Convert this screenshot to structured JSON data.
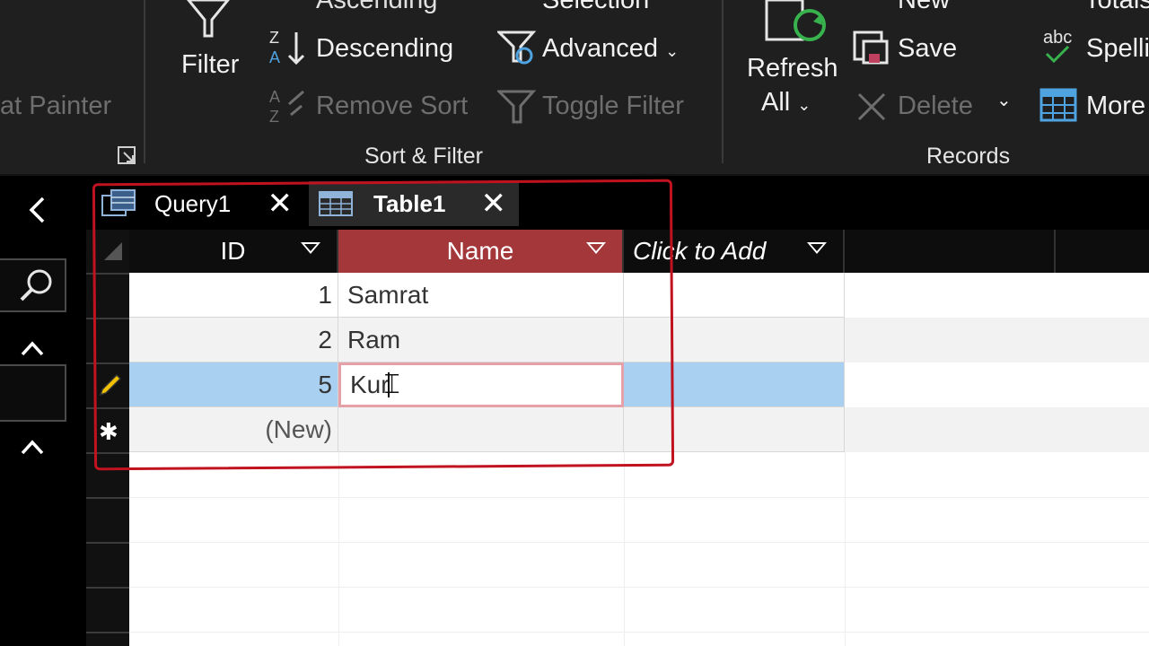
{
  "ribbon": {
    "partial_top": {
      "ascending": "Ascending",
      "selection": "Selection",
      "new": "New",
      "totals": "Totals"
    },
    "format_painter": "at Painter",
    "filter_label": "Filter",
    "descending": "Descending",
    "remove_sort": "Remove Sort",
    "advanced": "Advanced",
    "toggle_filter": "Toggle Filter",
    "group_sort_filter": "Sort & Filter",
    "refresh_line1": "Refresh",
    "refresh_line2": "All",
    "save": "Save",
    "delete": "Delete",
    "spelling": "Spelli",
    "more": "More",
    "group_records": "Records",
    "abc": "abc"
  },
  "tabs": [
    {
      "label": "Query1"
    },
    {
      "label": "Table1"
    }
  ],
  "datasheet": {
    "columns": [
      {
        "label": "ID"
      },
      {
        "label": "Name"
      },
      {
        "label": "Click to Add"
      }
    ],
    "rows": [
      {
        "id": "1",
        "name": "Samrat"
      },
      {
        "id": "2",
        "name": "Ram"
      },
      {
        "id": "5",
        "name": "Kur"
      },
      {
        "id": "(New)",
        "name": ""
      }
    ]
  },
  "colors": {
    "ribbon_bg": "#1f1f1f",
    "selected_header": "#a4373a",
    "selected_row": "#a9d0f0",
    "annotation": "#c1121f"
  }
}
